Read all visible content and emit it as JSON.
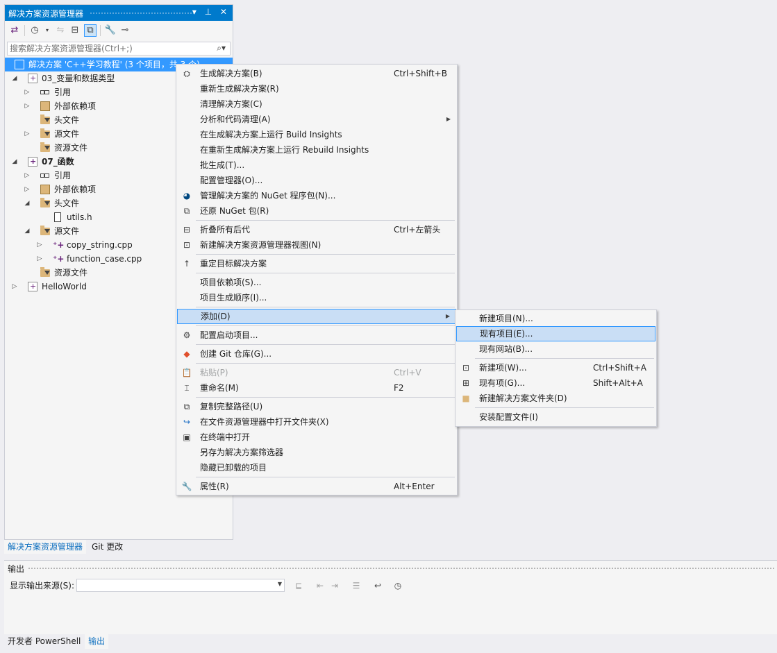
{
  "solution_explorer": {
    "title": "解决方案资源管理器",
    "title_buttons": "▾ ⊥ ✕",
    "search_placeholder": "搜索解决方案资源管理器(Ctrl+;)",
    "tree": {
      "solution": "解决方案 'C++学习教程' (3 个项目，共 3 个)",
      "project1": "03_变量和数据类型",
      "p1_refs": "引用",
      "p1_extdeps": "外部依赖项",
      "p1_headers": "头文件",
      "p1_sources": "源文件",
      "p1_resources": "资源文件",
      "project2": "07_函数",
      "p2_refs": "引用",
      "p2_extdeps": "外部依赖项",
      "p2_headers": "头文件",
      "p2_utils": "utils.h",
      "p2_sources": "源文件",
      "p2_copy": "copy_string.cpp",
      "p2_func": "function_case.cpp",
      "p2_resources": "资源文件",
      "project3": "HelloWorld"
    },
    "tabs": [
      "解决方案资源管理器",
      "Git 更改"
    ]
  },
  "output": {
    "title": "输出",
    "source_label": "显示输出来源(S):",
    "source_value": ""
  },
  "bottom_tabs": [
    "开发者 PowerShell",
    "输出"
  ],
  "context_menu": {
    "build": {
      "label": "生成解决方案(B)",
      "shortcut": "Ctrl+Shift+B"
    },
    "rebuild": {
      "label": "重新生成解决方案(R)"
    },
    "clean": {
      "label": "清理解决方案(C)"
    },
    "analyze": {
      "label": "分析和代码清理(A)"
    },
    "build_insights": {
      "label": "在生成解决方案上运行 Build Insights"
    },
    "rebuild_insights": {
      "label": "在重新生成解决方案上运行 Rebuild Insights"
    },
    "batch": {
      "label": "批生成(T)..."
    },
    "config_mgr": {
      "label": "配置管理器(O)..."
    },
    "nuget_manage": {
      "label": "管理解决方案的 NuGet 程序包(N)..."
    },
    "nuget_restore": {
      "label": "还原 NuGet 包(R)"
    },
    "collapse": {
      "label": "折叠所有后代",
      "shortcut": "Ctrl+左箭头"
    },
    "new_view": {
      "label": "新建解决方案资源管理器视图(N)"
    },
    "retarget": {
      "label": "重定目标解决方案"
    },
    "deps": {
      "label": "项目依赖项(S)..."
    },
    "build_order": {
      "label": "项目生成顺序(I)..."
    },
    "add": {
      "label": "添加(D)"
    },
    "startup": {
      "label": "配置启动项目..."
    },
    "git_repo": {
      "label": "创建 Git 仓库(G)..."
    },
    "paste": {
      "label": "粘贴(P)",
      "shortcut": "Ctrl+V"
    },
    "rename": {
      "label": "重命名(M)",
      "shortcut": "F2"
    },
    "copy_path": {
      "label": "复制完整路径(U)"
    },
    "open_folder": {
      "label": "在文件资源管理器中打开文件夹(X)"
    },
    "terminal": {
      "label": "在终端中打开"
    },
    "save_filter": {
      "label": "另存为解决方案筛选器"
    },
    "hide_unloaded": {
      "label": "隐藏已卸载的项目"
    },
    "properties": {
      "label": "属性(R)",
      "shortcut": "Alt+Enter"
    }
  },
  "add_submenu": {
    "new_project": {
      "label": "新建项目(N)..."
    },
    "existing_project": {
      "label": "现有项目(E)..."
    },
    "existing_website": {
      "label": "现有网站(B)..."
    },
    "new_item": {
      "label": "新建项(W)...",
      "shortcut": "Ctrl+Shift+A"
    },
    "existing_item": {
      "label": "现有项(G)...",
      "shortcut": "Shift+Alt+A"
    },
    "new_folder": {
      "label": "新建解决方案文件夹(D)"
    },
    "install_config": {
      "label": "安装配置文件(I)"
    }
  },
  "colors": {
    "title_bar": "#007acc",
    "selection": "#3399ff",
    "menu_highlight": "#c9def5"
  }
}
